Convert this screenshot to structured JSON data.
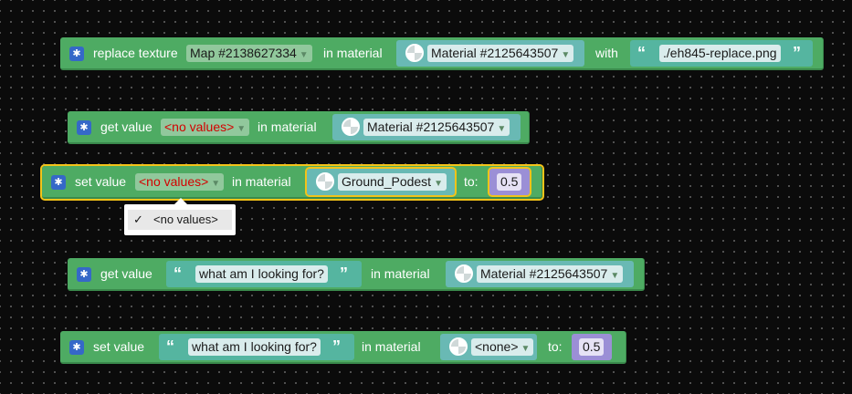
{
  "blocks": [
    {
      "label": "replace texture",
      "map_dropdown": "Map #2138627334",
      "in_material": "in material",
      "material": "Material #2125643507",
      "with": "with",
      "file": "./eh845-replace.png"
    },
    {
      "label": "get value",
      "value_dropdown": "<no values>",
      "in_material": "in material",
      "material": "Material #2125643507"
    },
    {
      "label": "set value",
      "value_dropdown": "<no values>",
      "in_material": "in material",
      "material": "Ground_Podest",
      "to": "to:",
      "number": "0.5"
    },
    {
      "label": "get value",
      "text": "what am I looking for?",
      "in_material": "in material",
      "material": "Material #2125643507"
    },
    {
      "label": "set value",
      "text": "what am I looking for?",
      "in_material": "in material",
      "material": "<none>",
      "to": "to:",
      "number": "0.5"
    }
  ],
  "dropdown_menu": {
    "check": "✓",
    "item": "<no values>"
  },
  "icons": {
    "gear": "gear-icon",
    "material": "material-sphere-icon",
    "dropdown": "chevron-down-icon"
  },
  "colors": {
    "block": "#4eab63",
    "material_slot": "#69b9b4",
    "string_slot": "#55b5a0",
    "number_slot": "#9b8fd6",
    "selection": "#f3c319",
    "error_text": "#d40000"
  }
}
